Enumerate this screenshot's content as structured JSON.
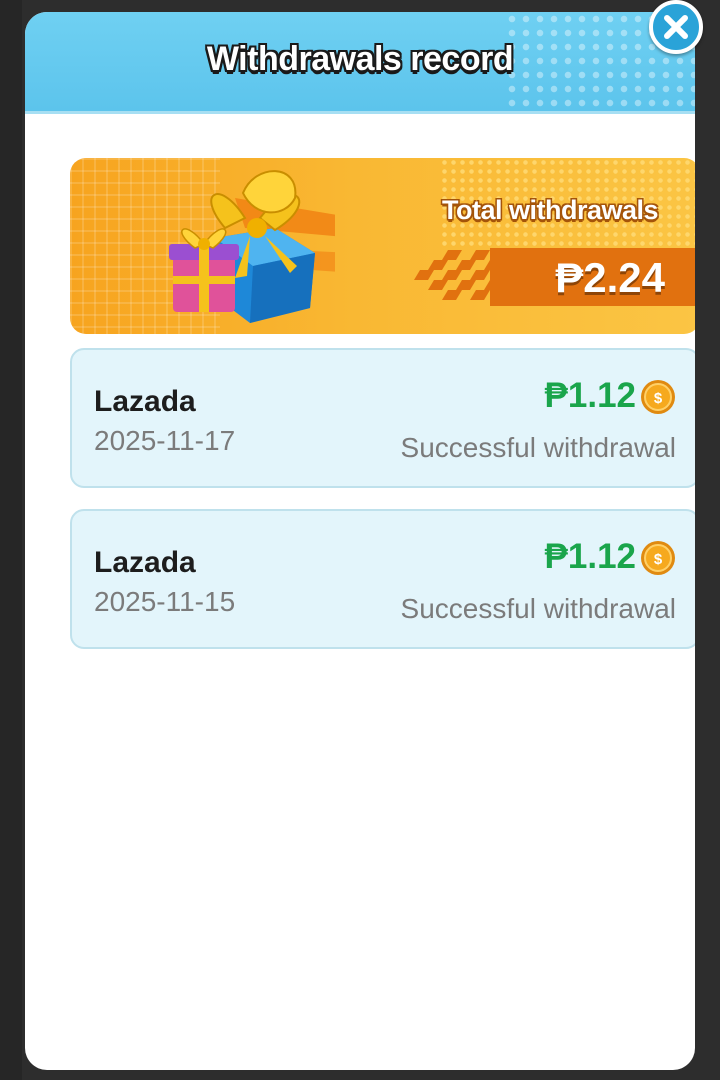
{
  "modal": {
    "title": "Withdrawals record",
    "close_icon": "close-icon"
  },
  "summary": {
    "label": "Total withdrawals",
    "amount": "₱2.24",
    "illustration": "gift-boxes"
  },
  "records": [
    {
      "source": "Lazada",
      "date": "2025-11-17",
      "amount": "₱1.12",
      "status": "Successful withdrawal",
      "icon": "coin-icon"
    },
    {
      "source": "Lazada",
      "date": "2025-11-15",
      "amount": "₱1.12",
      "status": "Successful withdrawal",
      "icon": "coin-icon"
    }
  ],
  "colors": {
    "header_bg": "#5cc4ec",
    "banner_bg": "#f9b833",
    "amount_green": "#1aa54b",
    "card_bg": "#e3f5fb"
  }
}
